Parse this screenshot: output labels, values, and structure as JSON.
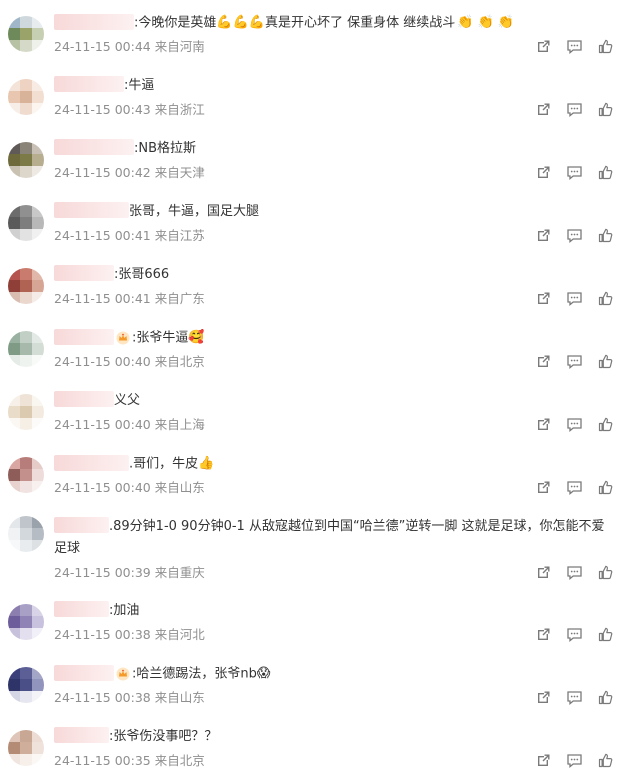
{
  "comments": [
    {
      "user_width": 80,
      "text": ":今晚你是英雄",
      "emoji": "💪💪💪",
      "text2": "真是开心坏了  保重身体 继续战斗",
      "emoji2": "👏 👏 👏",
      "meta": "24-11-15 00:44 来自河南",
      "avatar": [
        "#9fb7c9",
        "#cfd8dc",
        "#e7ecef",
        "#6e8a5a",
        "#9aa36a",
        "#c7cfb3",
        "#b7c2a5",
        "#d5dac8",
        "#eef0ea"
      ]
    },
    {
      "user_width": 70,
      "text": ":牛逼",
      "meta": "24-11-15 00:43 来自浙江",
      "avatar": [
        "#f4e3d9",
        "#eed2c2",
        "#f7ebe3",
        "#e8c6b0",
        "#d9b29a",
        "#f2dfd2",
        "#f8eee8",
        "#efdccf",
        "#fbf4ef"
      ]
    },
    {
      "user_width": 80,
      "text": ":NB格拉斯",
      "meta": "24-11-15 00:42 来自天津",
      "avatar": [
        "#5f5a58",
        "#8a8377",
        "#c8c0b5",
        "#6f6a3c",
        "#7c7a47",
        "#b7ae90",
        "#c9c2b2",
        "#ddd6cb",
        "#eee9e2"
      ]
    },
    {
      "user_width": 75,
      "text": "张哥，牛逼，国足大腿",
      "meta": "24-11-15 00:41 来自江苏",
      "avatar": [
        "#6c6c6c",
        "#909090",
        "#c8c8c8",
        "#5a5a5a",
        "#7e7e7e",
        "#b8b8b8",
        "#d0d0d0",
        "#e2e2e2",
        "#f0f0f0"
      ]
    },
    {
      "user_width": 60,
      "text": ":张哥666",
      "meta": "24-11-15 00:41 来自广东",
      "avatar": [
        "#b5544e",
        "#c97b6d",
        "#e0b7a9",
        "#8f3f38",
        "#b06253",
        "#d7a594",
        "#d8bdb0",
        "#ead7ce",
        "#f6ece7"
      ]
    },
    {
      "user_width": 60,
      "crown": true,
      "text": ":张爷牛逼",
      "emoji": "🥰",
      "meta": "24-11-15 00:40 来自北京",
      "avatar": [
        "#9ab1a2",
        "#c2cfc5",
        "#e3e9e4",
        "#7f9b86",
        "#a6b9ab",
        "#d3ddd5",
        "#e5ebe6",
        "#eff3f0",
        "#f8faf8"
      ]
    },
    {
      "user_width": 60,
      "text": "义父",
      "meta": "24-11-15 00:40 来自上海",
      "avatar": [
        "#f6f0e8",
        "#eee3d6",
        "#f9f5ef",
        "#e9dcc9",
        "#dccab0",
        "#f3ebe0",
        "#fbf8f4",
        "#f5efe6",
        "#fdfbf9"
      ]
    },
    {
      "user_width": 75,
      "text": ".哥们，牛皮",
      "emoji": "👍",
      "meta": "24-11-15 00:40 来自山东",
      "avatar": [
        "#d9a6a2",
        "#b77d7a",
        "#e6ccc9",
        "#8e5d5a",
        "#c4908b",
        "#eddcda",
        "#e7d2cf",
        "#f1e3e1",
        "#f8f0ef"
      ]
    },
    {
      "user_width": 55,
      "text": ".89分钟1-0 90分钟0-1 从敌寇越位到中国“哈兰德”逆转一脚 这就是足球，你怎能不爱足球",
      "meta": "24-11-15 00:39 来自重庆",
      "avatar": [
        "#e4e7ea",
        "#bfc5cb",
        "#9aa3ab",
        "#f0f2f4",
        "#d3d8dc",
        "#b5bcc3",
        "#f7f8f9",
        "#e9ecee",
        "#dde1e4"
      ]
    },
    {
      "user_width": 55,
      "text": ":加油",
      "meta": "24-11-15 00:38 来自河北",
      "avatar": [
        "#8c7fb0",
        "#a9a0c6",
        "#d8d3e7",
        "#6d5d9a",
        "#8f83b5",
        "#c9c2de",
        "#c8c1dc",
        "#e3dfee",
        "#f1eff7"
      ]
    },
    {
      "user_width": 60,
      "crown": true,
      "text": ":哈兰德踢法，张爷nb",
      "emoji": "😱",
      "meta": "24-11-15 00:38 来自山东",
      "avatar": [
        "#3b3f7a",
        "#5b5f95",
        "#a3a6c7",
        "#2f3468",
        "#4b4f88",
        "#9195bd",
        "#d5d6e5",
        "#e6e6f0",
        "#f3f3f8"
      ]
    },
    {
      "user_width": 55,
      "text": ":张爷伤没事吧？？",
      "meta": "24-11-15 00:35 来自北京",
      "avatar": [
        "#dfc5b7",
        "#c8a794",
        "#ecdcd3",
        "#b48c76",
        "#cfae9b",
        "#efe2da",
        "#f1e6df",
        "#f7efea",
        "#fbf7f4"
      ]
    }
  ]
}
